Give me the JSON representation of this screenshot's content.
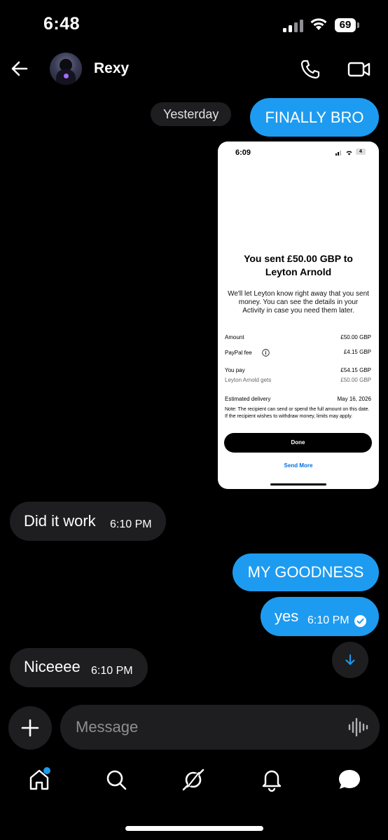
{
  "status_bar": {
    "time": "6:48",
    "battery": "69"
  },
  "header": {
    "contact_name": "Rexy"
  },
  "messages": {
    "date_separator": "Yesterday",
    "finally": "FINALLY BRO",
    "did_it_work": {
      "text": "Did it work",
      "time": "6:10 PM"
    },
    "my_goodness": "MY GOODNESS",
    "yes": {
      "text": "yes",
      "time": "6:10 PM"
    },
    "niceeee": {
      "text": "Niceeee",
      "time": "6:10 PM"
    }
  },
  "receipt": {
    "time": "6:09",
    "battery": "4",
    "title_line1": "You sent £50.00 GBP to",
    "title_line2": "Leyton Arnold",
    "subtitle": "We'll let Leyton know right away that you sent money. You can see the details in your Activity in case you need them later.",
    "amount_label": "Amount",
    "amount_value": "£50.00 GBP",
    "fee_label": "PayPal fee",
    "fee_value": "£4.15 GBP",
    "pay_label": "You pay",
    "pay_value": "£54.15 GBP",
    "gets_label": "Leyton Arnold gets",
    "gets_value": "£50.00 GBP",
    "delivery_label": "Estimated delivery",
    "delivery_value": "May 16, 2026",
    "note": "Note: The recipient can send or spend the full amount on this date. If the recipient wishes to withdraw money, limits may apply.",
    "done_label": "Done",
    "send_more_label": "Send More"
  },
  "composer": {
    "placeholder": "Message"
  },
  "colors": {
    "accent": "#1d9bf0",
    "bubble_in": "#1e1e20",
    "background": "#000000"
  },
  "nav": {
    "items": [
      "home-icon",
      "search-icon",
      "grok-icon",
      "bell-icon",
      "messages-icon"
    ]
  }
}
